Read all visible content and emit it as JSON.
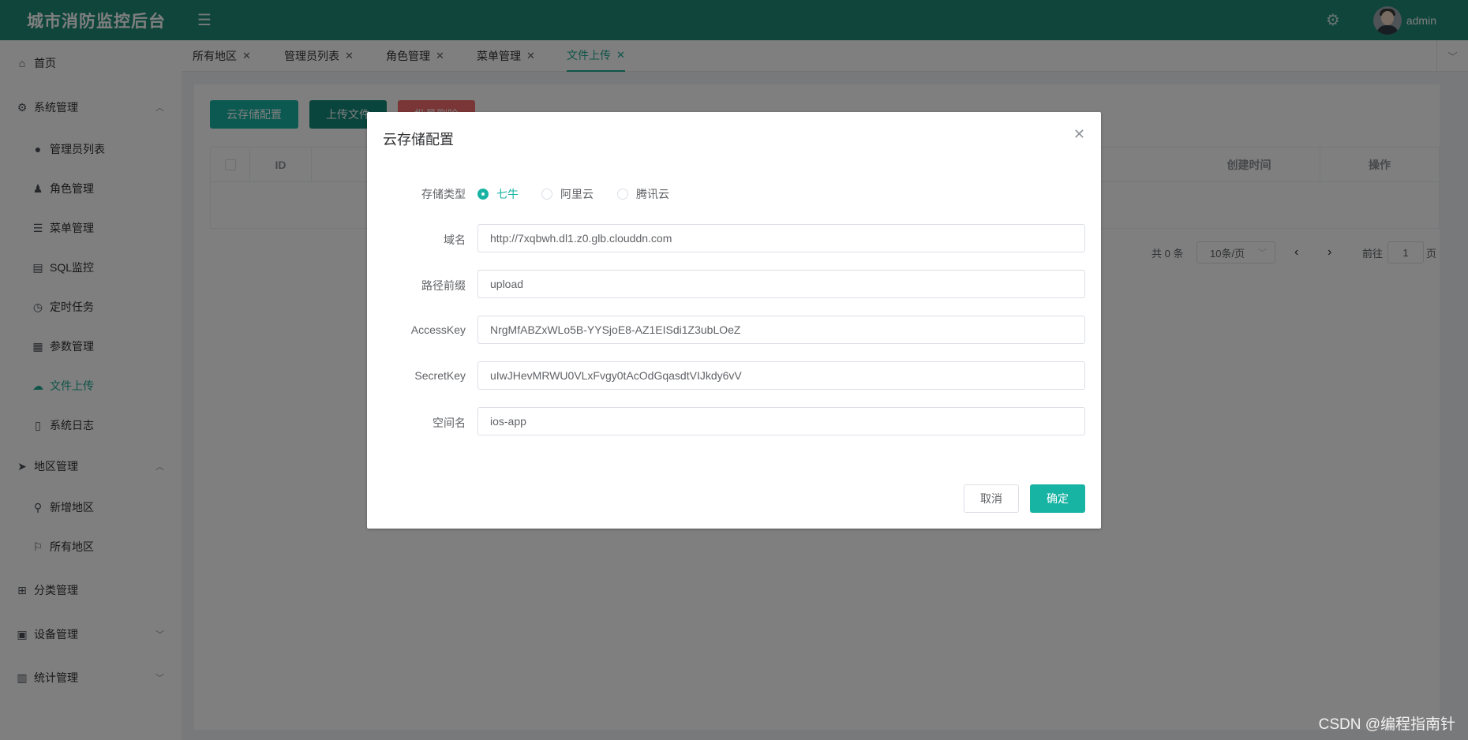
{
  "app": {
    "title": "城市消防监控后台",
    "user": "admin"
  },
  "sidebar": {
    "items": [
      {
        "label": "首页",
        "icon": "home-icon"
      },
      {
        "label": "系统管理",
        "icon": "gear-icon"
      },
      {
        "label": "管理员列表",
        "icon": "user-icon"
      },
      {
        "label": "角色管理",
        "icon": "user-role-icon"
      },
      {
        "label": "菜单管理",
        "icon": "list-icon"
      },
      {
        "label": "SQL监控",
        "icon": "database-icon"
      },
      {
        "label": "定时任务",
        "icon": "clock-icon"
      },
      {
        "label": "参数管理",
        "icon": "document-settings-icon"
      },
      {
        "label": "文件上传",
        "icon": "cloud-upload-icon"
      },
      {
        "label": "系统日志",
        "icon": "document-icon"
      },
      {
        "label": "地区管理",
        "icon": "location-arrow-icon"
      },
      {
        "label": "新增地区",
        "icon": "map-pin-icon"
      },
      {
        "label": "所有地区",
        "icon": "signpost-icon"
      },
      {
        "label": "分类管理",
        "icon": "grid-icon"
      },
      {
        "label": "设备管理",
        "icon": "device-icon"
      },
      {
        "label": "统计管理",
        "icon": "bar-chart-icon"
      }
    ]
  },
  "tabs": [
    {
      "label": "所有地区"
    },
    {
      "label": "管理员列表"
    },
    {
      "label": "角色管理"
    },
    {
      "label": "菜单管理"
    },
    {
      "label": "文件上传"
    }
  ],
  "toolbar": {
    "cloud_config": "云存储配置",
    "upload_file": "上传文件",
    "batch_delete": "批量删除"
  },
  "table": {
    "columns": [
      "ID",
      "创建时间",
      "操作"
    ]
  },
  "pagination": {
    "total": "共 0 条",
    "page_size": "10条/页",
    "goto_prefix": "前往",
    "current": "1",
    "goto_suffix": "页"
  },
  "dialog": {
    "title": "云存储配置",
    "storage_type_label": "存储类型",
    "storage_options": [
      "七牛",
      "阿里云",
      "腾讯云"
    ],
    "selected_storage": "七牛",
    "fields": [
      {
        "label": "域名",
        "value": "http://7xqbwh.dl1.z0.glb.clouddn.com"
      },
      {
        "label": "路径前缀",
        "value": "upload"
      },
      {
        "label": "AccessKey",
        "value": "NrgMfABZxWLo5B-YYSjoE8-AZ1EISdi1Z3ubLOeZ"
      },
      {
        "label": "SecretKey",
        "value": "uIwJHevMRWU0VLxFvgy0tAcOdGqasdtVIJkdy6vV"
      },
      {
        "label": "空间名",
        "value": "ios-app"
      }
    ],
    "cancel": "取消",
    "confirm": "确定"
  },
  "watermark": "CSDN @编程指南针",
  "colors": {
    "header": "#1e8a77",
    "accent": "#17b3a3",
    "danger": "#f56c6c"
  }
}
